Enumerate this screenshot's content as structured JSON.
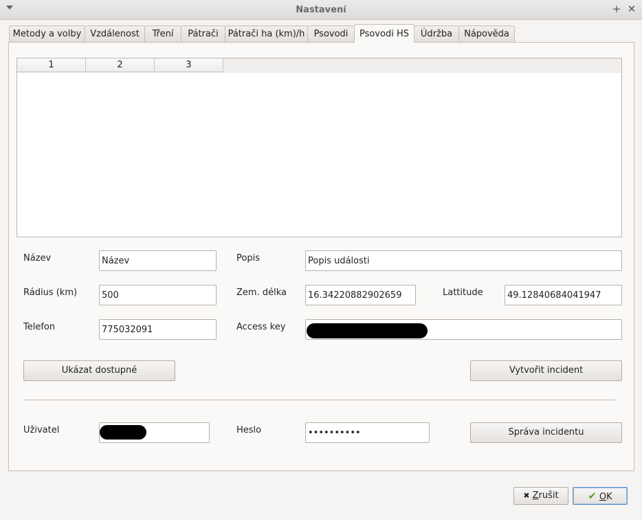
{
  "window": {
    "title": "Nastavení",
    "menu_icon": "menu-triangle-icon",
    "maximize_glyph": "+",
    "close_glyph": "✕"
  },
  "tabs": [
    {
      "label": "Metody a volby"
    },
    {
      "label": "Vzdálenost"
    },
    {
      "label": "Tření"
    },
    {
      "label": "Pátrači"
    },
    {
      "label": "Pátrači ha (km)/h"
    },
    {
      "label": "Psovodi"
    },
    {
      "label": "Psovodi HS",
      "active": true
    },
    {
      "label": "Údržba"
    },
    {
      "label": "Nápověda"
    }
  ],
  "table": {
    "columns": [
      "1",
      "2",
      "3"
    ],
    "rows": []
  },
  "form": {
    "nazev_label": "Název",
    "nazev_value": "Název",
    "popis_label": "Popis",
    "popis_value": "Popis události",
    "radius_label": "Rádius (km)",
    "radius_value": "500",
    "delka_label": "Zem. délka",
    "delka_value": "16.34220882902659",
    "lat_label": "Lattitude",
    "lat_value": "49.12840684041947",
    "telefon_label": "Telefon",
    "telefon_value": "775032091",
    "access_label": "Access key",
    "show_button": "Ukázat dostupné",
    "create_button": "Vytvořit incident",
    "user_label": "Uživatel",
    "password_label": "Heslo",
    "password_value": "••••••••••",
    "manage_button": "Správa incidentu"
  },
  "footer": {
    "cancel_icon": "✖",
    "cancel_accel": "Z",
    "cancel_rest": "rušit",
    "ok_icon": "✔",
    "ok_accel": "O",
    "ok_rest": "K"
  },
  "colors": {
    "ok_check": "#5aa02c",
    "redaction": "#000000"
  }
}
